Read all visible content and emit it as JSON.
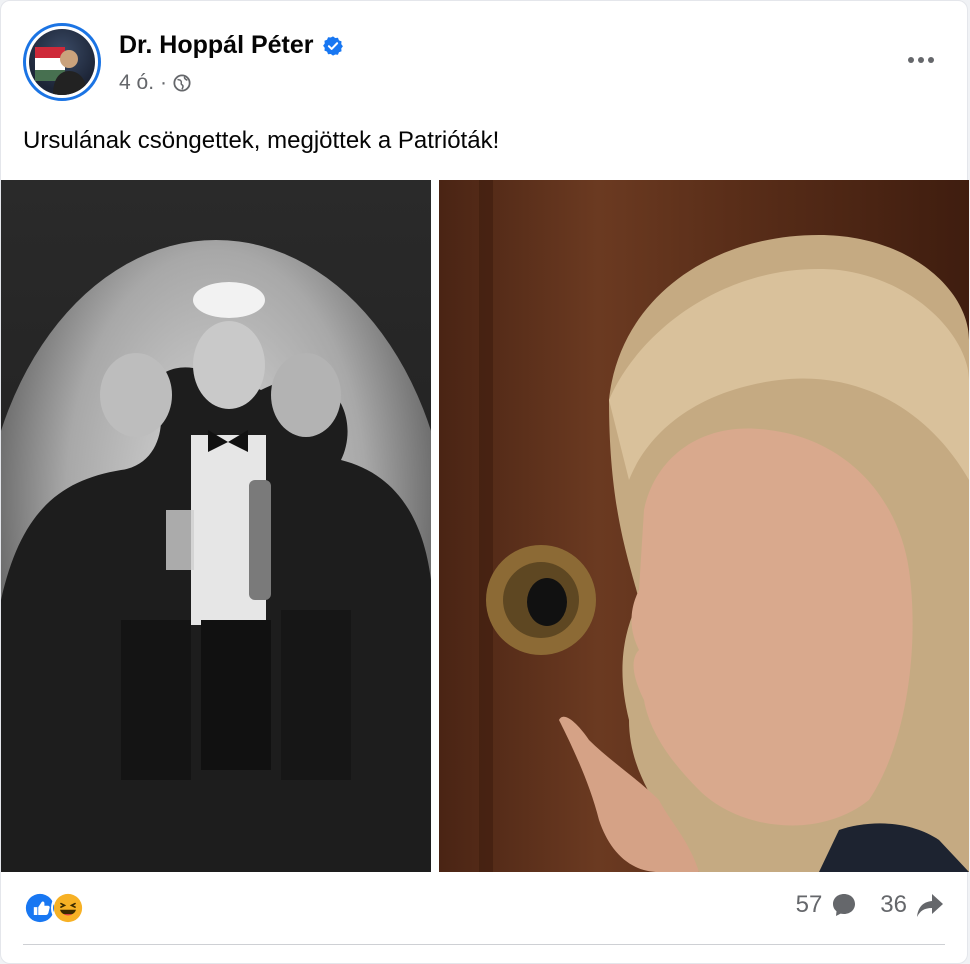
{
  "post": {
    "author": "Dr. Hoppál Péter",
    "time": "4 ó.",
    "separator": "·",
    "caption": "Ursulának csöngettek, megjöttek a Patrióták!",
    "comments_count": "57",
    "shares_count": "36"
  },
  "icons": {
    "verified": "verified-badge-icon",
    "audience": "globe-icon",
    "more": "more-options-icon",
    "like": "like-reaction-icon",
    "haha": "haha-reaction-icon",
    "comment": "comment-icon",
    "share": "share-icon"
  },
  "colors": {
    "accent": "#1b74e4",
    "like": "#1877f2",
    "haha": "#f7b125",
    "secondary_text": "#65676b"
  }
}
